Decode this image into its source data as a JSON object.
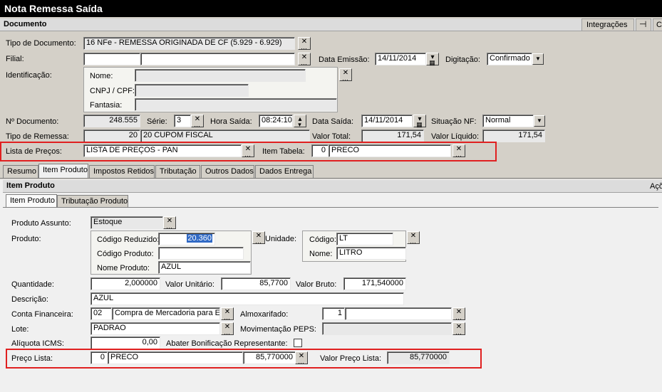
{
  "window": {
    "title": "Nota Remessa Saída"
  },
  "documento": {
    "header": "Documento",
    "integracoes_label": "Integrações",
    "pin_icon": "pin-icon",
    "tipo_documento_label": "Tipo de Documento:",
    "tipo_documento_value": "16 NFe - REMESSA ORIGINADA DE CF (5.929 - 6.929)",
    "filial_label": "Filial:",
    "filial_value": "",
    "data_emissao_label": "Data Emissão:",
    "data_emissao_value": "14/11/2014",
    "digitacao_label": "Digitação:",
    "digitacao_value": "Confirmado",
    "identificacao_label": "Identificação:",
    "nome_label": "Nome:",
    "cnpj_label": "CNPJ / CPF:",
    "fantasia_label": "Fantasia:",
    "num_documento_label": "Nº Documento:",
    "num_documento_value": "248.555",
    "serie_label": "Série:",
    "serie_value": "3",
    "hora_saida_label": "Hora Saída:",
    "hora_saida_value": "08:24:10",
    "data_saida_label": "Data Saída:",
    "data_saida_value": "14/11/2014",
    "situacao_label": "Situação NF:",
    "situacao_value": "Normal",
    "tipo_remessa_label": "Tipo de Remessa:",
    "tipo_remessa_code": "20",
    "tipo_remessa_value": "20 CUPOM FISCAL",
    "valor_total_label": "Valor Total:",
    "valor_total_value": "171,54",
    "valor_liquido_label": "Valor Líquido:",
    "valor_liquido_value": "171,54",
    "lista_precos_label": "Lista de Preços:",
    "lista_precos_value": "LISTA DE PREÇOS - PAN",
    "item_tabela_label": "Item Tabela:",
    "item_tabela_code": "0",
    "item_tabela_value": "PRECO"
  },
  "tabs": [
    {
      "label": "Resumo"
    },
    {
      "label": "Item Produto"
    },
    {
      "label": "Impostos Retidos"
    },
    {
      "label": "Tributação"
    },
    {
      "label": "Outros Dados"
    },
    {
      "label": "Dados Entrega"
    }
  ],
  "item_produto": {
    "header": "Item Produto",
    "acoes_label": "Açõ",
    "subtabs": [
      {
        "label": "Item Produto"
      },
      {
        "label": "Tributação Produto"
      }
    ],
    "produto_assunto_label": "Produto Assunto:",
    "produto_assunto_value": "Estoque",
    "produto_label": "Produto:",
    "codigo_reduzido_label": "Código Reduzido:",
    "codigo_reduzido_value": "20.360",
    "codigo_produto_label": "Código Produto:",
    "codigo_produto_value": "",
    "nome_produto_label": "Nome Produto:",
    "nome_produto_value": "AZUL",
    "unidade_label": "Unidade:",
    "codigo_label": "Código:",
    "codigo_value": "LT",
    "nome_label": "Nome:",
    "nome_value": "LITRO",
    "quantidade_label": "Quantidade:",
    "quantidade_value": "2,000000",
    "valor_unitario_label": "Valor Unitário:",
    "valor_unitario_value": "85,7700",
    "valor_bruto_label": "Valor Bruto:",
    "valor_bruto_value": "171,540000",
    "descricao_label": "Descrição:",
    "descricao_value": "AZUL",
    "conta_financeira_label": "Conta Financeira:",
    "conta_financeira_code": "02",
    "conta_financeira_value": "Compra de Mercadoria para Est",
    "almoxarifado_label": "Almoxarifado:",
    "almoxarifado_code": "1",
    "almoxarifado_value": "",
    "lote_label": "Lote:",
    "lote_value": "PADRAO",
    "movimentacao_label": "Movimentação PEPS:",
    "movimentacao_value": "",
    "aliquota_label": "Alíquota ICMS:",
    "aliquota_value": "0,00",
    "abater_label": "Abater Bonificação Representante:",
    "preco_lista_label": "Preço Lista:",
    "preco_lista_code": "0",
    "preco_lista_name": "PRECO",
    "preco_lista_value": "85,770000",
    "valor_preco_lista_label": "Valor Preço Lista:",
    "valor_preco_lista_value": "85,770000"
  }
}
